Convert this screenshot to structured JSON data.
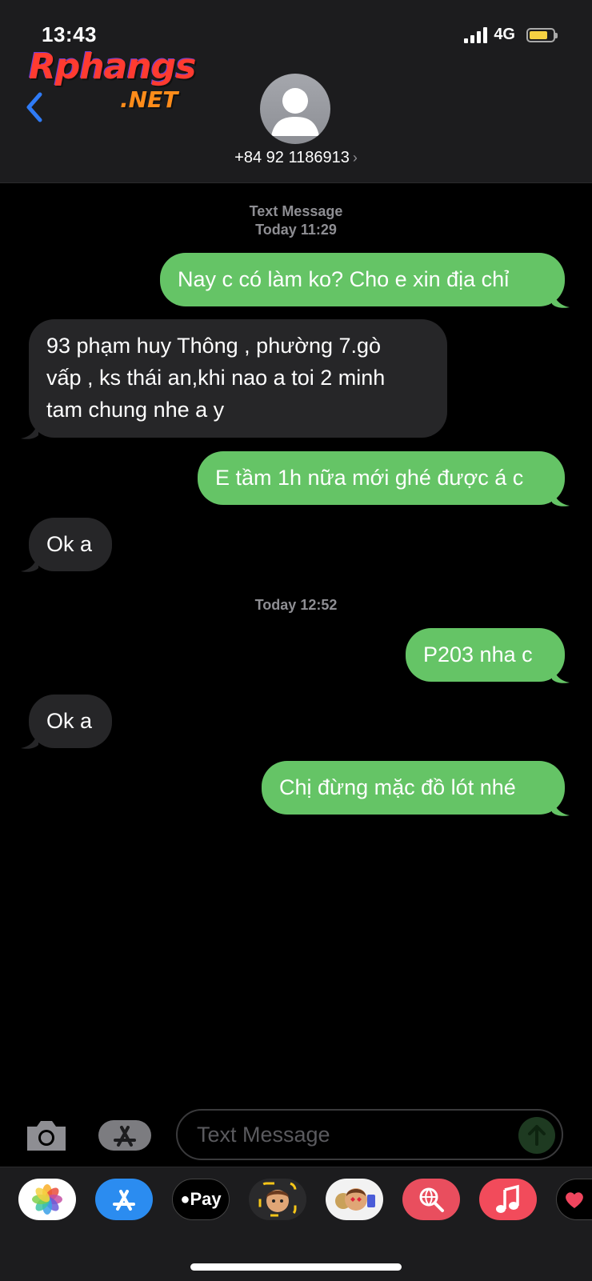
{
  "status": {
    "time": "13:43",
    "network": "4G"
  },
  "watermark": {
    "main": "Rphangs",
    "suffix": ".NET"
  },
  "contact": {
    "number": "+84 92 1186913",
    "chevron": "›"
  },
  "thread": {
    "header_label": "Text Message",
    "header_time": "Today 11:29",
    "second_time": "Today 12:52",
    "messages": [
      {
        "dir": "out",
        "text": "Nay c có làm ko? Cho e xin địa chỉ"
      },
      {
        "dir": "in",
        "lines": [
          "93 phạm huy Thông , phường 7.gò",
          "vấp , ks thái an,khi nao a toi 2 minh",
          "tam chung nhe a y"
        ]
      },
      {
        "dir": "out",
        "text": "E tầm 1h nữa mới ghé được á c"
      },
      {
        "dir": "in",
        "text": "Ok a"
      },
      {
        "dir": "out",
        "text": "P203 nha c"
      },
      {
        "dir": "in",
        "text": "Ok a"
      },
      {
        "dir": "out",
        "text": "Chị đừng mặc đồ lót nhé"
      }
    ]
  },
  "composer": {
    "placeholder": "Text Message",
    "send_icon": "arrow-up-icon"
  },
  "app_tray": {
    "apps": [
      "photos-icon",
      "app-store-icon",
      "apple-pay-icon",
      "memoji-icon",
      "animoji-icon",
      "web-images-icon",
      "music-icon",
      "digital-touch-icon"
    ],
    "apple_pay_label": "Pay"
  },
  "colors": {
    "outgoing": "#65c466",
    "incoming": "#262628",
    "battery": "#f5d142",
    "link_blue": "#2f7bf6"
  }
}
